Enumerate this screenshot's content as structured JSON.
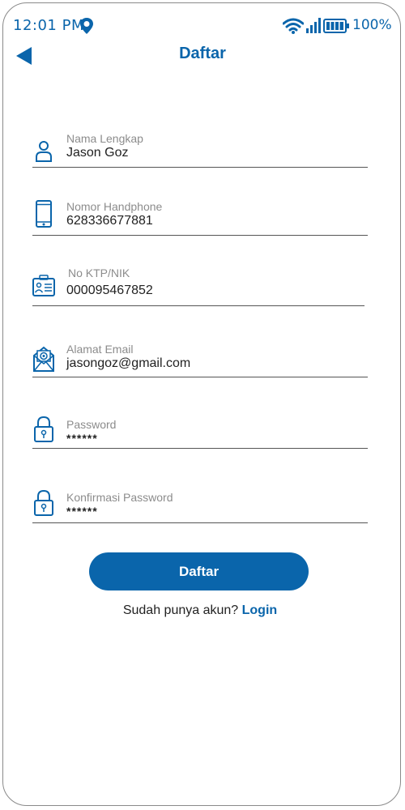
{
  "status_bar": {
    "time": "12:01 PM",
    "battery": "100%",
    "icons": [
      "location-pin-icon",
      "wifi-icon",
      "signal-icon",
      "battery-icon"
    ]
  },
  "header": {
    "title": "Daftar",
    "back_icon": "back-arrow-icon"
  },
  "form": {
    "fields": [
      {
        "label": "Nama Lengkap",
        "value": "Jason Goz",
        "icon": "person-icon"
      },
      {
        "label": "Nomor Handphone",
        "value": "628336677881",
        "icon": "phone-icon"
      },
      {
        "label": "No KTP/NIK",
        "value": "000095467852",
        "icon": "id-card-icon"
      },
      {
        "label": "Alamat Email",
        "value": "jasongoz@gmail.com",
        "icon": "email-icon"
      },
      {
        "label": "Password",
        "value": "******",
        "icon": "lock-icon"
      },
      {
        "label": "Konfirmasi Password",
        "value": "******",
        "icon": "lock-icon"
      }
    ],
    "submit_label": "Daftar"
  },
  "footer": {
    "prompt": "Sudah punya akun?",
    "login_label": "Login"
  },
  "colors": {
    "accent": "#0a65ab",
    "text": "#222222",
    "muted": "#8c8c8c",
    "underline": "#555555"
  }
}
